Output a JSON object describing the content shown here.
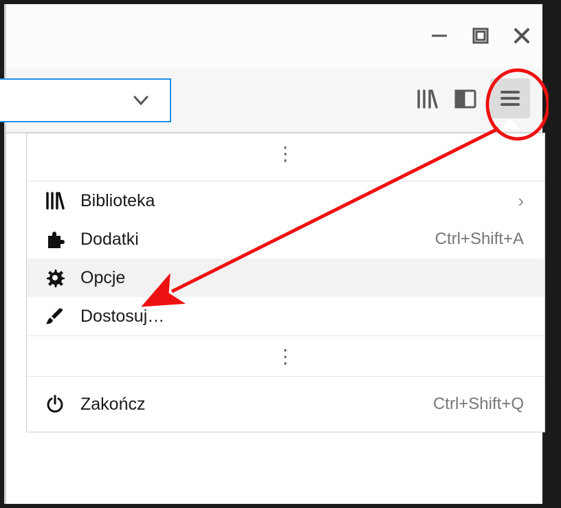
{
  "menu": {
    "library": {
      "label": "Biblioteka"
    },
    "addons": {
      "label": "Dodatki",
      "shortcut": "Ctrl+Shift+A"
    },
    "options": {
      "label": "Opcje"
    },
    "customize": {
      "label": "Dostosuj…"
    },
    "exit": {
      "label": "Zakończ",
      "shortcut": "Ctrl+Shift+Q"
    }
  }
}
